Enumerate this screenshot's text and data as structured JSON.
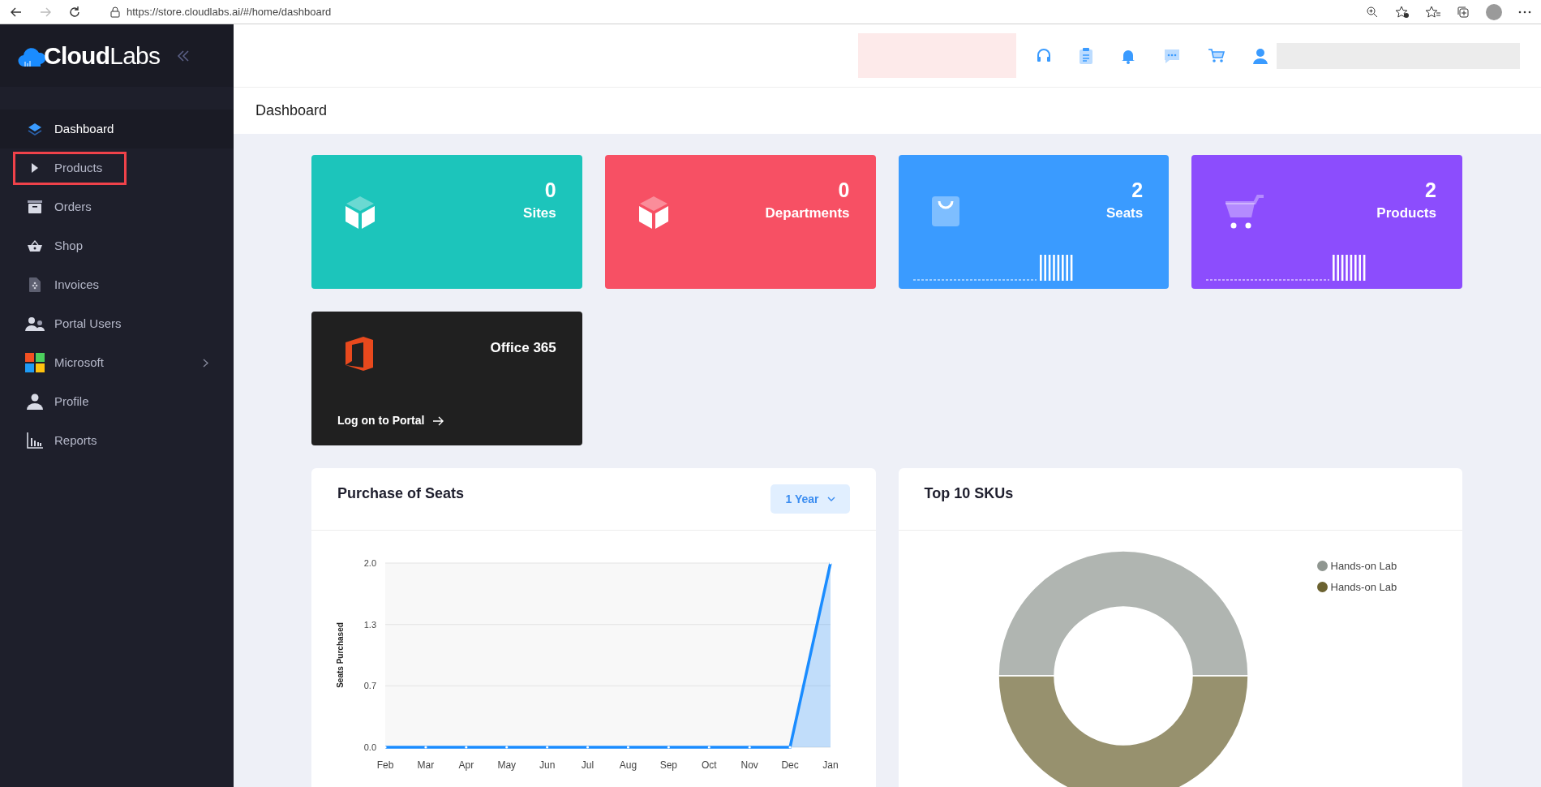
{
  "browser": {
    "url": "https://store.cloudlabs.ai/#/home/dashboard"
  },
  "sidebar": {
    "logo": "**Cloud**Labs",
    "items": [
      {
        "label": "Dashboard",
        "selected": true,
        "highlighted": false,
        "has_submenu": false
      },
      {
        "label": "Products",
        "selected": false,
        "highlighted": true,
        "has_submenu": false
      },
      {
        "label": "Orders",
        "selected": false,
        "highlighted": false,
        "has_submenu": false
      },
      {
        "label": "Shop",
        "selected": false,
        "highlighted": false,
        "has_submenu": false
      },
      {
        "label": "Invoices",
        "selected": false,
        "highlighted": false,
        "has_submenu": false
      },
      {
        "label": "Portal Users",
        "selected": false,
        "highlighted": false,
        "has_submenu": false
      },
      {
        "label": "Microsoft",
        "selected": false,
        "highlighted": false,
        "has_submenu": true
      },
      {
        "label": "Profile",
        "selected": false,
        "highlighted": false,
        "has_submenu": false
      },
      {
        "label": "Reports",
        "selected": false,
        "highlighted": false,
        "has_submenu": false
      }
    ]
  },
  "breadcrumb": "Dashboard",
  "stat_cards": [
    {
      "value": "0",
      "label": "Sites",
      "color": "#1cc5bb",
      "trend_graphic": false
    },
    {
      "value": "0",
      "label": "Departments",
      "color": "#f75064",
      "trend_graphic": false
    },
    {
      "value": "2",
      "label": "Seats",
      "color": "#3a9bff",
      "trend_graphic": true
    },
    {
      "value": "2",
      "label": "Products",
      "color": "#8c4dfd",
      "trend_graphic": true
    }
  ],
  "office_card": {
    "title": "Office 365",
    "link": "Log on to Portal"
  },
  "seats_chart": {
    "title": "Purchase of Seats",
    "range_button": "1 Year",
    "chart_data": {
      "type": "area",
      "ylabel": "Seats Purchased",
      "categories": [
        "Feb",
        "Mar",
        "Apr",
        "May",
        "Jun",
        "Jul",
        "Aug",
        "Sep",
        "Oct",
        "Nov",
        "Dec",
        "Jan"
      ],
      "series": [
        {
          "color": "#1a8cff",
          "values": [
            0,
            0,
            0,
            0,
            0,
            0,
            0,
            0,
            0,
            0,
            0,
            2
          ]
        }
      ],
      "ylim": [
        0,
        2
      ],
      "yticks": [
        {
          "value": 0,
          "label": "0.0"
        },
        {
          "value": 0.667,
          "label": "0.7"
        },
        {
          "value": 1.333,
          "label": "1.3"
        },
        {
          "value": 2,
          "label": "2.0"
        }
      ]
    }
  },
  "sku_chart": {
    "title": "Top 10 SKUs",
    "legend": [
      {
        "label": "Hands-on Lab",
        "color": "#8f9690"
      },
      {
        "label": "Hands-on Lab",
        "color": "#6b6230"
      }
    ]
  }
}
